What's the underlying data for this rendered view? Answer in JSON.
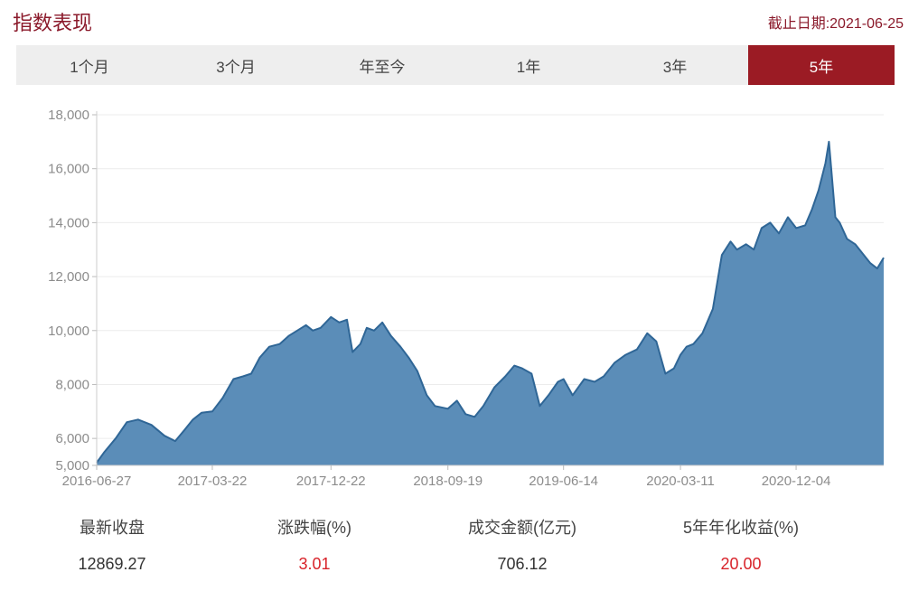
{
  "header": {
    "title": "指数表现",
    "as_of": "截止日期:2021-06-25"
  },
  "tabs": [
    {
      "label": "1个月",
      "active": false
    },
    {
      "label": "3个月",
      "active": false
    },
    {
      "label": "年至今",
      "active": false
    },
    {
      "label": "1年",
      "active": false
    },
    {
      "label": "3年",
      "active": false
    },
    {
      "label": "5年",
      "active": true
    }
  ],
  "colors": {
    "accent": "#9b1b24",
    "area_fill": "#5b8db8",
    "line": "#2f6696",
    "up": "#d8232a"
  },
  "chart_data": {
    "type": "area",
    "x_start": "2016-06-27",
    "x_end": "2021-06-25",
    "x_tick_labels": [
      "2016-06-27",
      "2017-03-22",
      "2017-12-22",
      "2018-09-19",
      "2019-06-14",
      "2020-03-11",
      "2020-12-04"
    ],
    "y_ticks": [
      5000,
      6000,
      8000,
      10000,
      12000,
      14000,
      16000,
      18000
    ],
    "y_tick_labels": [
      "5,000",
      "6,000",
      "8,000",
      "10,000",
      "12,000",
      "14,000",
      "16,000",
      "18,000"
    ],
    "ylim": [
      5000,
      18000
    ],
    "grid": true,
    "x": [
      "2016-06-27",
      "2016-07-15",
      "2016-08-10",
      "2016-09-05",
      "2016-10-01",
      "2016-11-01",
      "2016-12-01",
      "2016-12-26",
      "2017-01-16",
      "2017-02-05",
      "2017-02-25",
      "2017-03-22",
      "2017-04-15",
      "2017-05-10",
      "2017-06-01",
      "2017-06-20",
      "2017-07-10",
      "2017-08-01",
      "2017-08-25",
      "2017-09-15",
      "2017-10-05",
      "2017-10-25",
      "2017-11-10",
      "2017-11-28",
      "2017-12-22",
      "2018-01-10",
      "2018-01-28",
      "2018-02-10",
      "2018-02-28",
      "2018-03-15",
      "2018-04-01",
      "2018-04-20",
      "2018-05-10",
      "2018-06-01",
      "2018-06-20",
      "2018-07-10",
      "2018-08-01",
      "2018-08-20",
      "2018-09-19",
      "2018-10-10",
      "2018-10-30",
      "2018-11-20",
      "2018-12-10",
      "2019-01-05",
      "2019-01-30",
      "2019-02-20",
      "2019-03-10",
      "2019-04-01",
      "2019-04-20",
      "2019-05-10",
      "2019-06-01",
      "2019-06-14",
      "2019-07-05",
      "2019-08-01",
      "2019-08-25",
      "2019-09-15",
      "2019-10-10",
      "2019-11-05",
      "2019-12-01",
      "2019-12-25",
      "2020-01-15",
      "2020-02-05",
      "2020-02-25",
      "2020-03-11",
      "2020-03-25",
      "2020-04-10",
      "2020-05-01",
      "2020-05-25",
      "2020-06-15",
      "2020-07-05",
      "2020-07-20",
      "2020-08-10",
      "2020-08-28",
      "2020-09-15",
      "2020-10-05",
      "2020-10-25",
      "2020-11-15",
      "2020-12-04",
      "2020-12-25",
      "2021-01-10",
      "2021-01-25",
      "2021-02-10",
      "2021-02-18",
      "2021-03-05",
      "2021-03-15",
      "2021-04-01",
      "2021-04-20",
      "2021-05-10",
      "2021-05-25",
      "2021-06-10",
      "2021-06-25"
    ],
    "values": [
      5100,
      5500,
      6000,
      6600,
      6700,
      6500,
      6100,
      5900,
      6300,
      6700,
      6950,
      7000,
      7500,
      8200,
      8300,
      8400,
      9000,
      9400,
      9500,
      9800,
      10000,
      10200,
      10000,
      10100,
      10500,
      10300,
      10400,
      9200,
      9500,
      10100,
      10000,
      10300,
      9800,
      9400,
      9000,
      8500,
      7600,
      7200,
      7100,
      7400,
      6900,
      6800,
      7200,
      7900,
      8300,
      8700,
      8600,
      8400,
      7200,
      7600,
      8100,
      8200,
      7600,
      8200,
      8100,
      8300,
      8800,
      9100,
      9300,
      9900,
      9600,
      8400,
      8600,
      9100,
      9400,
      9500,
      9900,
      10800,
      12800,
      13300,
      13000,
      13200,
      13000,
      13800,
      14000,
      13600,
      14200,
      13800,
      13900,
      14500,
      15200,
      16200,
      17000,
      14200,
      14000,
      13400,
      13200,
      12800,
      12500,
      12300,
      12700
    ]
  },
  "stats": [
    {
      "label": "最新收盘",
      "value": "12869.27",
      "highlight": false
    },
    {
      "label": "涨跌幅(%)",
      "value": "3.01",
      "highlight": true
    },
    {
      "label": "成交金额(亿元)",
      "value": "706.12",
      "highlight": false
    },
    {
      "label": "5年年化收益(%)",
      "value": "20.00",
      "highlight": true
    }
  ]
}
